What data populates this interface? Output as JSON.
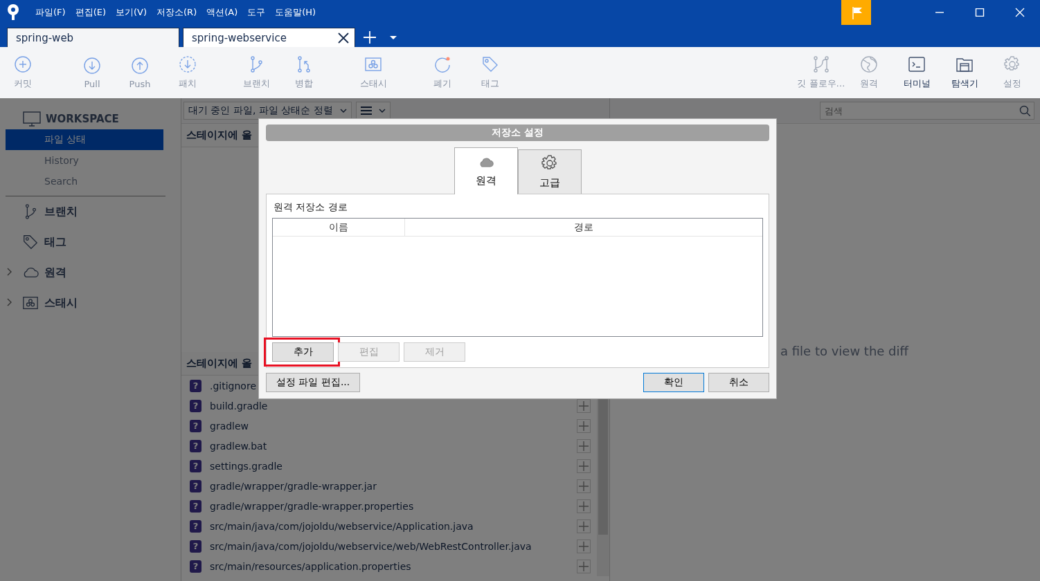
{
  "window": {
    "menu": [
      "파일(F)",
      "편집(E)",
      "보기(V)",
      "저장소(R)",
      "액션(A)",
      "도구",
      "도움말(H)"
    ]
  },
  "repo_tabs": [
    {
      "label": "spring-web",
      "selected": false
    },
    {
      "label": "spring-webservice",
      "selected": true
    }
  ],
  "toolbar": {
    "left": [
      [
        {
          "label": "커밋",
          "disabled": true
        }
      ],
      [
        {
          "label": "Pull",
          "disabled": true
        },
        {
          "label": "Push",
          "disabled": true
        },
        {
          "label": "패치",
          "disabled": true
        }
      ],
      [
        {
          "label": "브랜치",
          "disabled": true
        },
        {
          "label": "병합",
          "disabled": true
        }
      ],
      [
        {
          "label": "스태시",
          "disabled": true
        }
      ],
      [
        {
          "label": "폐기",
          "disabled": true
        },
        {
          "label": "태그",
          "disabled": true
        }
      ]
    ],
    "right": [
      {
        "label": "깃 플로우…",
        "disabled": true
      },
      {
        "label": "원격",
        "disabled": true
      },
      {
        "label": "터미널",
        "disabled": false
      },
      {
        "label": "탐색기",
        "disabled": false
      },
      {
        "label": "설정",
        "disabled": true
      }
    ]
  },
  "sidebar": {
    "workspace": "WORKSPACE",
    "items": [
      {
        "label": "파일 상태",
        "selected": true
      },
      {
        "label": "History",
        "selected": false
      },
      {
        "label": "Search",
        "selected": false
      }
    ],
    "sections": [
      {
        "label": "브랜치",
        "collapsible": false
      },
      {
        "label": "태그",
        "collapsible": false
      },
      {
        "label": "원격",
        "collapsible": true
      },
      {
        "label": "스태시",
        "collapsible": true
      }
    ]
  },
  "file_status": {
    "sort_dropdown": "대기 중인 파일, 파일 상태순 정렬",
    "staged_header": "스테이지에 올",
    "unstaged_header": "스테이지에 올",
    "files": [
      {
        "status": "?",
        "name": ".gitignore",
        "stage_button": false
      },
      {
        "status": "?",
        "name": "build.gradle"
      },
      {
        "status": "?",
        "name": "gradlew"
      },
      {
        "status": "?",
        "name": "gradlew.bat"
      },
      {
        "status": "?",
        "name": "settings.gradle"
      },
      {
        "status": "?",
        "name": "gradle/wrapper/gradle-wrapper.jar"
      },
      {
        "status": "?",
        "name": "gradle/wrapper/gradle-wrapper.properties"
      },
      {
        "status": "?",
        "name": "src/main/java/com/jojoldu/webservice/Application.java"
      },
      {
        "status": "?",
        "name": "src/main/java/com/jojoldu/webservice/web/WebRestController.java"
      },
      {
        "status": "?",
        "name": "src/main/resources/application.properties"
      }
    ]
  },
  "search": {
    "placeholder": "검색"
  },
  "diff_hint": "a file to view the diff",
  "dialog": {
    "title": "저장소 설정",
    "tabs": [
      {
        "label": "원격",
        "selected": true
      },
      {
        "label": "고급",
        "selected": false
      }
    ],
    "section_label": "원격 저장소 경로",
    "columns": [
      "이름",
      "경로"
    ],
    "actions": [
      {
        "label": "추가",
        "disabled": false,
        "highlighted": true
      },
      {
        "label": "편집",
        "disabled": true,
        "highlighted": false
      },
      {
        "label": "제거",
        "disabled": true,
        "highlighted": false
      }
    ],
    "edit_config": "설정 파일 편집...",
    "buttons": [
      {
        "label": "확인",
        "default": true
      },
      {
        "label": "취소",
        "default": false
      }
    ]
  }
}
